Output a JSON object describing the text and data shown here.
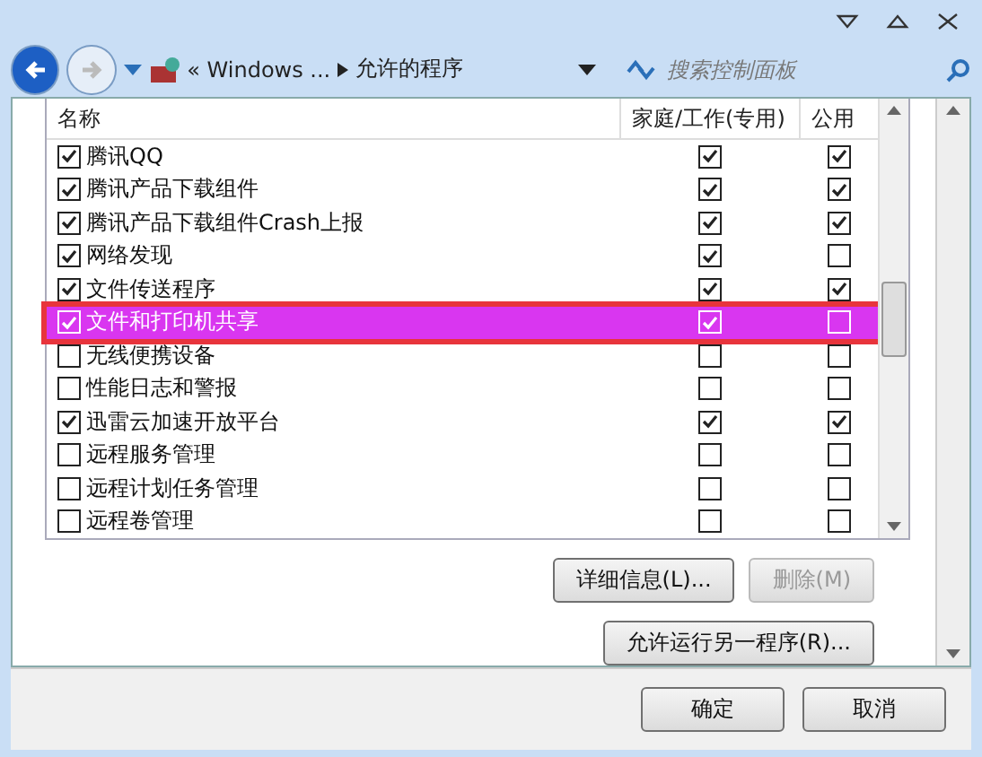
{
  "address_bar": {
    "crumbs": [
      "« Windows ...",
      "允许的程序"
    ],
    "search_placeholder": "搜索控制面板"
  },
  "table": {
    "columns": [
      "名称",
      "家庭/工作(专用)",
      "公用"
    ],
    "rows": [
      {
        "name": "腾讯QQ",
        "checked": true,
        "private": true,
        "public": true,
        "selected": false
      },
      {
        "name": "腾讯产品下载组件",
        "checked": true,
        "private": true,
        "public": true,
        "selected": false
      },
      {
        "name": "腾讯产品下载组件Crash上报",
        "checked": true,
        "private": true,
        "public": true,
        "selected": false
      },
      {
        "name": "网络发现",
        "checked": true,
        "private": true,
        "public": false,
        "selected": false
      },
      {
        "name": "文件传送程序",
        "checked": true,
        "private": true,
        "public": true,
        "selected": false
      },
      {
        "name": "文件和打印机共享",
        "checked": true,
        "private": true,
        "public": false,
        "selected": true
      },
      {
        "name": "无线便携设备",
        "checked": false,
        "private": false,
        "public": false,
        "selected": false
      },
      {
        "name": "性能日志和警报",
        "checked": false,
        "private": false,
        "public": false,
        "selected": false
      },
      {
        "name": "迅雷云加速开放平台",
        "checked": true,
        "private": true,
        "public": true,
        "selected": false
      },
      {
        "name": "远程服务管理",
        "checked": false,
        "private": false,
        "public": false,
        "selected": false
      },
      {
        "name": "远程计划任务管理",
        "checked": false,
        "private": false,
        "public": false,
        "selected": false
      },
      {
        "name": "远程卷管理",
        "checked": false,
        "private": false,
        "public": false,
        "selected": false
      }
    ]
  },
  "list_buttons": [
    {
      "label": "详细信息(L)...",
      "disabled": false
    },
    {
      "label": "删除(M)",
      "disabled": true
    }
  ],
  "allow_button": "允许运行另一程序(R)...",
  "footer_buttons": [
    "确定",
    "取消"
  ]
}
